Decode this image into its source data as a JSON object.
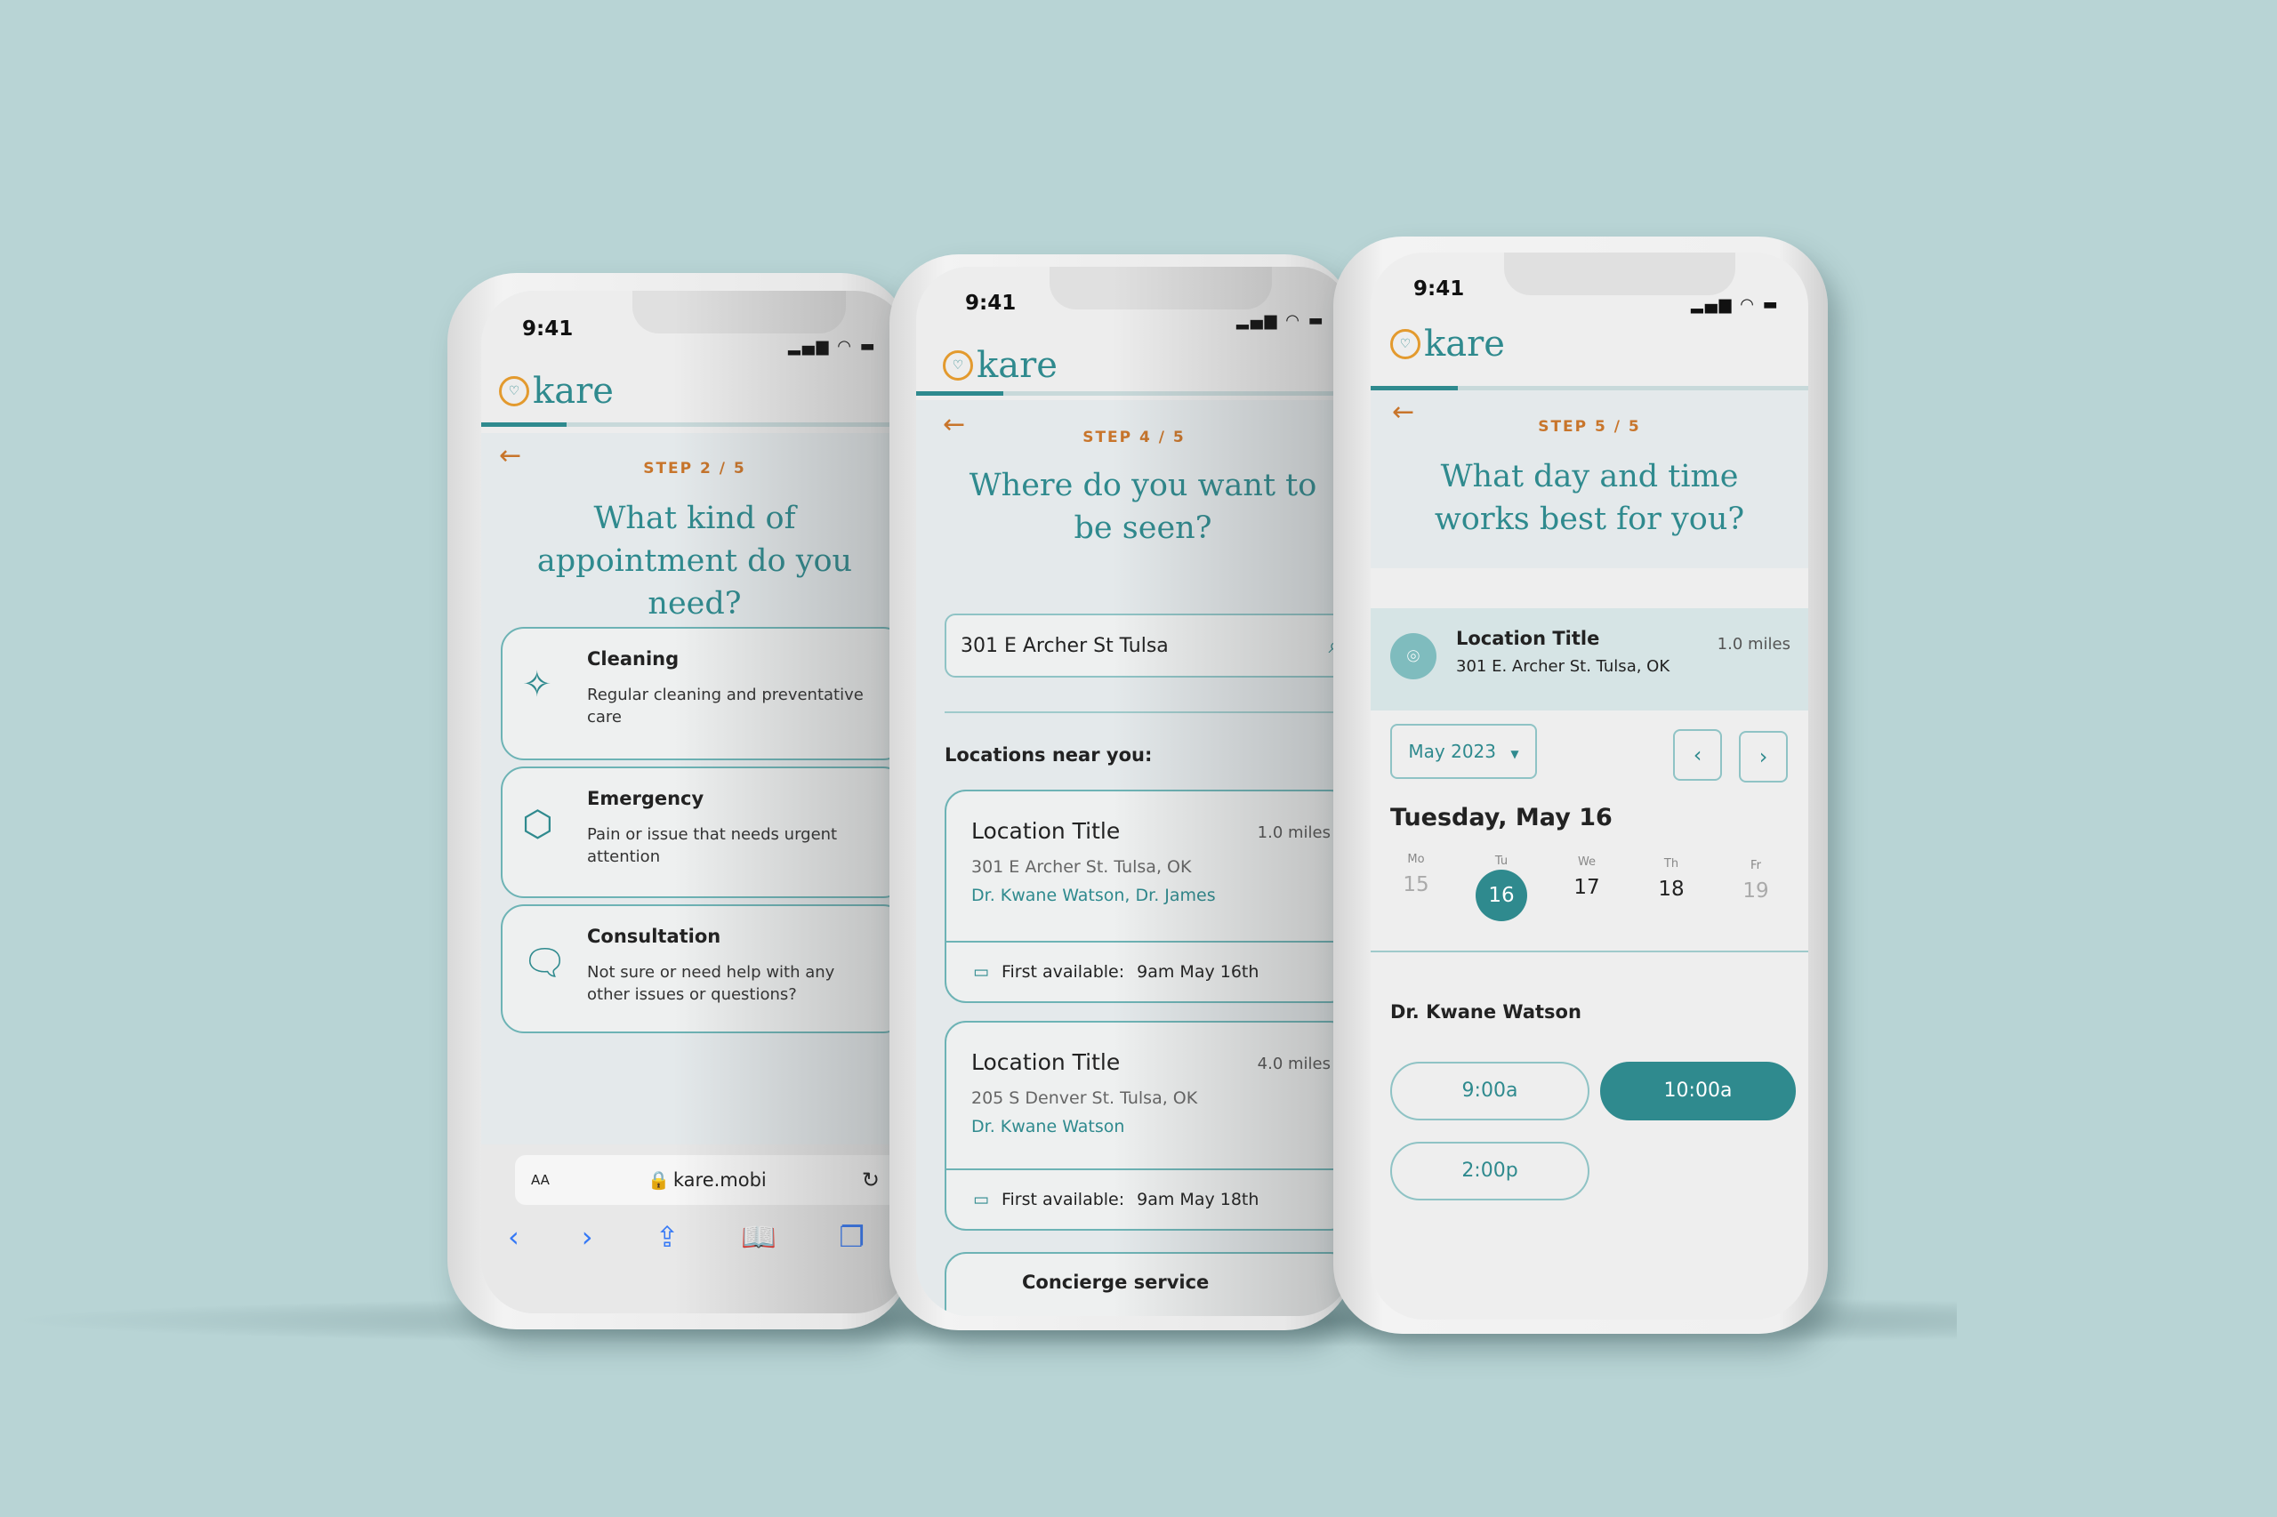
{
  "colors": {
    "background": "#b8d4d5",
    "accent": "#2f8a8e",
    "step": "#c8752b",
    "logo_ring": "#e39a2e"
  },
  "status_time": "9:41",
  "brand": "kare",
  "phones": [
    {
      "step": "STEP 2 / 5",
      "progress": 0.2,
      "title": "What kind of appointment do you need?",
      "options": [
        {
          "icon": "sparkle-icon",
          "label": "Cleaning",
          "desc": "Regular cleaning and preventative care"
        },
        {
          "icon": "alert-octagon-icon",
          "label": "Emergency",
          "desc": "Pain or issue that needs urgent attention"
        },
        {
          "icon": "chat-bubbles-icon",
          "label": "Consultation",
          "desc": "Not sure or need help with any other issues or questions?"
        }
      ],
      "browser": {
        "text_size": "AA",
        "url": "kare.mobi"
      }
    },
    {
      "step": "STEP 4 / 5",
      "progress": 0.2,
      "title": "Where do you want to be seen?",
      "search_value": "301 E Archer St Tulsa",
      "near_label": "Locations near you:",
      "first_available_label": "First available:",
      "locations": [
        {
          "title": "Location Title",
          "distance": "1.0 miles",
          "address": "301 E Archer St. Tulsa, OK",
          "doctors": "Dr. Kwane Watson, Dr. James",
          "first_available": "9am May 16th"
        },
        {
          "title": "Location Title",
          "distance": "4.0 miles",
          "address": "205 S Denver St. Tulsa, OK",
          "doctors": "Dr. Kwane Watson",
          "first_available": "9am May 18th"
        }
      ],
      "concierge": "Concierge service"
    },
    {
      "step": "STEP 5 / 5",
      "progress": 0.2,
      "title": "What day and time works best for you?",
      "location": {
        "title": "Location Title",
        "address": "301 E. Archer St. Tulsa, OK",
        "distance": "1.0 miles"
      },
      "month": "May 2023",
      "date_heading": "Tuesday, May 16",
      "days": [
        {
          "label": "Mo",
          "num": "15",
          "state": "disabled"
        },
        {
          "label": "Tu",
          "num": "16",
          "state": "selected"
        },
        {
          "label": "We",
          "num": "17",
          "state": "available"
        },
        {
          "label": "Th",
          "num": "18",
          "state": "available"
        },
        {
          "label": "Fr",
          "num": "19",
          "state": "disabled"
        }
      ],
      "doctor": "Dr. Kwane Watson",
      "slots": [
        {
          "time": "9:00a",
          "selected": false
        },
        {
          "time": "10:00a",
          "selected": true
        },
        {
          "time": "2:00p",
          "selected": false
        }
      ]
    }
  ]
}
